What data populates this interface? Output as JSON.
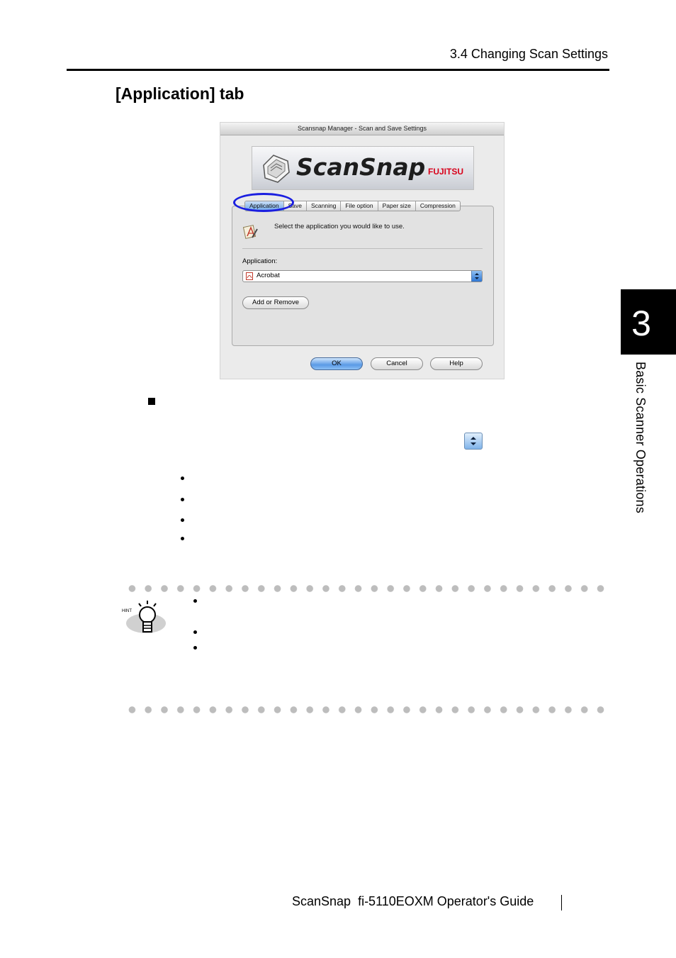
{
  "header": {
    "section": "3.4 Changing Scan Settings",
    "heading": "[Application] tab"
  },
  "chapter_tab": {
    "number": "3",
    "title": "Basic Scanner Operations"
  },
  "dialog": {
    "title": "Scansnap Manager - Scan and Save Settings",
    "logo_text": "ScanSnap",
    "logo_brand": "FUJITSU",
    "tabs": [
      "Application",
      "Save",
      "Scanning",
      "File option",
      "Paper size",
      "Compression"
    ],
    "selected_tab": "Application",
    "instruction": "Select the application you would like to use.",
    "application_label": "Application:",
    "application_value": "Acrobat",
    "add_remove_label": "Add or Remove",
    "buttons": {
      "ok": "OK",
      "cancel": "Cancel",
      "help": "Help"
    }
  },
  "hint": {
    "label": "HINT"
  },
  "footer": {
    "text": "ScanSnap  fi-5110EOXM Operator's Guide"
  },
  "colors": {
    "highlight_ring": "#1a1ee0",
    "chapter_tab_bg": "#000000",
    "accent_blue": "#5a9ae6",
    "fujitsu_red": "#d8001a"
  }
}
